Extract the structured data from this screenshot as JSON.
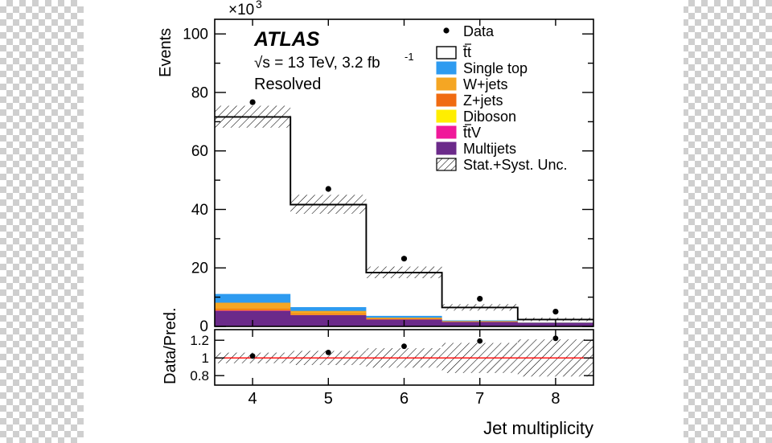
{
  "figure": {
    "exponent_label": "×10",
    "exponent_sup": "3",
    "y_axis_label": "Events",
    "x_axis_label": "Jet multiplicity",
    "ratio_y_label": "Data/Pred.",
    "atlas_tag": "ATLAS",
    "energy_line": "√s = 13 TeV, 3.2 fb",
    "energy_sup": "-1",
    "region_label": "Resolved"
  },
  "legend": {
    "entries": [
      {
        "label": "Data",
        "marker": "point",
        "color": "#000000"
      },
      {
        "label": "t̄t",
        "marker": "open-box",
        "color": "#ffffff"
      },
      {
        "label": "Single top",
        "marker": "box",
        "color": "#2e9bf0"
      },
      {
        "label": "W+jets",
        "marker": "box",
        "color": "#f5a623"
      },
      {
        "label": "Z+jets",
        "marker": "box",
        "color": "#f06b12"
      },
      {
        "label": "Diboson",
        "marker": "box",
        "color": "#ffee00"
      },
      {
        "label": "t̄tV",
        "marker": "box",
        "color": "#f0189a"
      },
      {
        "label": "Multijets",
        "marker": "box",
        "color": "#6b2a8a"
      },
      {
        "label": "Stat.+Syst. Unc.",
        "marker": "hatch",
        "color": "#000000"
      }
    ]
  },
  "chart_data": {
    "type": "bar",
    "title": "",
    "xlabel": "Jet multiplicity",
    "ylabel": "Events",
    "y_scale_factor": 1000,
    "xlim": [
      3.5,
      8.5
    ],
    "ylim": [
      0,
      105000
    ],
    "y_ticks": [
      0,
      20,
      40,
      60,
      80,
      100
    ],
    "y_tick_labels": [
      "0",
      "20",
      "40",
      "60",
      "80",
      "100"
    ],
    "x_ticks": [
      4,
      5,
      6,
      7,
      8
    ],
    "x_tick_labels": [
      "4",
      "5",
      "6",
      "7",
      "8"
    ],
    "categories": [
      4,
      5,
      6,
      7,
      8
    ],
    "series": [
      {
        "name": "Multijets",
        "color": "#6b2a8a",
        "values": [
          4200,
          2200,
          700,
          250,
          100
        ]
      },
      {
        "name": "t̄tV",
        "color": "#f0189a",
        "values": [
          100,
          80,
          50,
          30,
          15
        ]
      },
      {
        "name": "Diboson",
        "color": "#ffee00",
        "values": [
          150,
          100,
          60,
          30,
          15
        ]
      },
      {
        "name": "Z+jets",
        "color": "#f06b12",
        "values": [
          400,
          250,
          150,
          70,
          30
        ]
      },
      {
        "name": "W+jets",
        "color": "#f5a623",
        "values": [
          2100,
          1000,
          400,
          160,
          60
        ]
      },
      {
        "name": "Single top",
        "color": "#2e9bf0",
        "values": [
          3000,
          1300,
          600,
          250,
          100
        ]
      },
      {
        "name": "t̄t",
        "color": "#ffffff",
        "values": [
          61500,
          36500,
          16500,
          5700,
          2000
        ]
      }
    ],
    "total_prediction": [
      71450,
      41430,
      18460,
      6490,
      2320
    ],
    "data_points": [
      76500,
      46000,
      21000,
      7200,
      2800
    ],
    "uncertainty_band": [
      {
        "x": 4,
        "low": 68000,
        "high": 75500
      },
      {
        "x": 5,
        "low": 38500,
        "high": 45000
      },
      {
        "x": 6,
        "low": 16500,
        "high": 20500
      },
      {
        "x": 7,
        "low": 5400,
        "high": 7600
      },
      {
        "x": 8,
        "low": 1800,
        "high": 3000
      }
    ],
    "ratio": {
      "ylim": [
        0.7,
        1.32
      ],
      "y_ticks": [
        0.8,
        1,
        1.2
      ],
      "y_tick_labels": [
        "0.8",
        "1",
        "1.2"
      ],
      "values": [
        1.02,
        1.06,
        1.13,
        1.19,
        1.22
      ],
      "band": [
        {
          "x": 4,
          "low": 0.94,
          "high": 1.06
        },
        {
          "x": 5,
          "low": 0.92,
          "high": 1.08
        },
        {
          "x": 6,
          "low": 0.89,
          "high": 1.11
        },
        {
          "x": 7,
          "low": 0.83,
          "high": 1.17
        },
        {
          "x": 8,
          "low": 0.79,
          "high": 1.21
        }
      ],
      "reference_line": 1.0,
      "reference_color": "#ff0000"
    },
    "grid": false,
    "legend_position": "upper right"
  }
}
